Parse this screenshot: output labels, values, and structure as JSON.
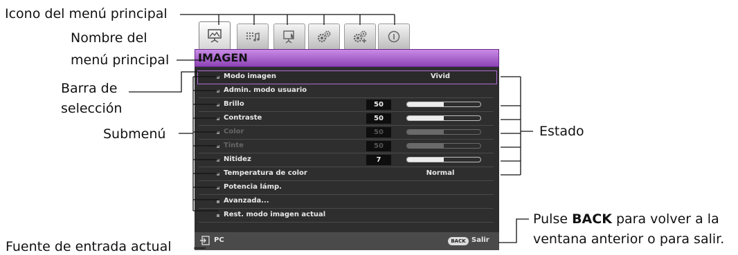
{
  "callouts": {
    "main_menu_icon": "Icono del menú principal",
    "main_menu_name_1": "Nombre del",
    "main_menu_name_2": "menú principal",
    "selection_bar_1": "Barra de",
    "selection_bar_2": "selección",
    "submenu": "Submenú",
    "status": "Estado",
    "back_1_pre": "Pulse ",
    "back_1_key": "BACK",
    "back_1_post": " para volver a la",
    "back_2": "ventana anterior o para salir.",
    "input_source": "Fuente de entrada actual"
  },
  "osd": {
    "menu_title": "IMAGEN",
    "tabs": [
      {
        "icon": "picture-icon",
        "active": true
      },
      {
        "icon": "audio-settings-icon",
        "active": false
      },
      {
        "icon": "display-icon",
        "active": false
      },
      {
        "icon": "gear-icon",
        "active": false
      },
      {
        "icon": "advanced-gear-icon",
        "active": false
      },
      {
        "icon": "info-icon",
        "active": false
      }
    ],
    "rows": [
      {
        "label": "Modo imagen",
        "status": "Vivid",
        "selected": true
      },
      {
        "label": "Admin. modo usuario"
      },
      {
        "label": "Brillo",
        "value": "50",
        "level": 0.5
      },
      {
        "label": "Contraste",
        "value": "50",
        "level": 0.5
      },
      {
        "label": "Color",
        "value": "50",
        "level": 0.5,
        "dim": true
      },
      {
        "label": "Tinte",
        "value": "50",
        "level": 0.5,
        "dim": true
      },
      {
        "label": "Nitidez",
        "value": "7",
        "level": 0.5
      },
      {
        "label": "Temperatura de color",
        "status": "Normal"
      },
      {
        "label": "Potencia lámp."
      },
      {
        "label": "Avanzada..."
      },
      {
        "label": "Rest. modo imagen actual"
      }
    ],
    "footer": {
      "source": "PC",
      "back_key": "BACK",
      "exit_label": "Salir"
    },
    "colors": {
      "title_bar": "#a45cc9",
      "body_bg": "#2e2e2e",
      "selection_border": "#b06bd6"
    }
  }
}
